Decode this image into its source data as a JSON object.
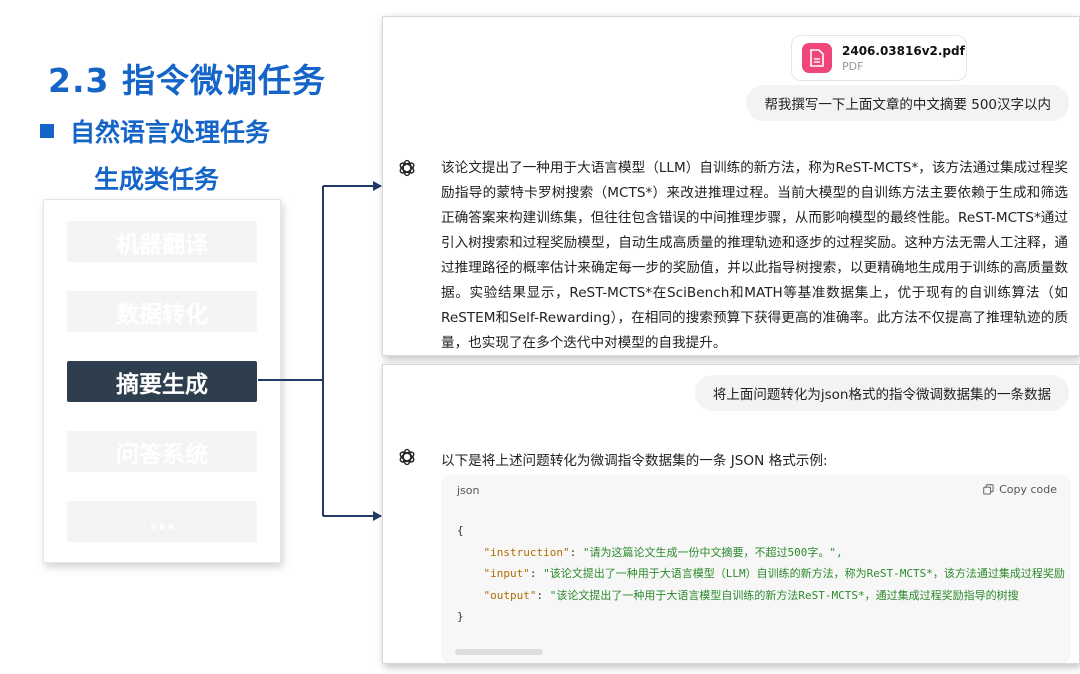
{
  "slide": {
    "title": "2.3 指令微调任务",
    "bullet": "自然语言处理任务",
    "subheading": "生成类任务",
    "tasks": [
      {
        "label": "机器翻译",
        "active": false
      },
      {
        "label": "数据转化",
        "active": false
      },
      {
        "label": "摘要生成",
        "active": true
      },
      {
        "label": "问答系统",
        "active": false
      },
      {
        "label": "...",
        "active": false
      }
    ]
  },
  "chat_top": {
    "file": {
      "name": "2406.03816v2.pdf",
      "type": "PDF"
    },
    "user_message": "帮我撰写一下上面文章的中文摘要 500汉字以内",
    "assistant_answer": "该论文提出了一种用于大语言模型（LLM）自训练的新方法，称为ReST-MCTS*，该方法通过集成过程奖励指导的蒙特卡罗树搜索（MCTS*）来改进推理过程。当前大模型的自训练方法主要依赖于生成和筛选正确答案来构建训练集，但往往包含错误的中间推理步骤，从而影响模型的最终性能。ReST-MCTS*通过引入树搜索和过程奖励模型，自动生成高质量的推理轨迹和逐步的过程奖励。这种方法无需人工注释，通过推理路径的概率估计来确定每一步的奖励值，并以此指导树搜索，以更精确地生成用于训练的高质量数据。实验结果显示，ReST-MCTS*在SciBench和MATH等基准数据集上，优于现有的自训练算法（如ReSTEM和Self-Rewarding），在相同的搜索预算下获得更高的准确率。此方法不仅提高了推理轨迹的质量，也实现了在多个迭代中对模型的自我提升。"
  },
  "chat_bottom": {
    "user_message": "将上面问题转化为json格式的指令微调数据集的一条数据",
    "assistant_intro": "以下是将上述问题转化为微调指令数据集的一条 JSON 格式示例:",
    "code": {
      "language": "json",
      "copy_label": "Copy code",
      "open_brace": "{",
      "close_brace": "}",
      "lines": [
        {
          "key": "\"instruction\"",
          "value": "\"请为这篇论文生成一份中文摘要，不超过500字。\","
        },
        {
          "key": "\"input\"",
          "value": "\"该论文提出了一种用于大语言模型（LLM）自训练的新方法，称为ReST-MCTS*，该方法通过集成过程奖励"
        },
        {
          "key": "\"output\"",
          "value": "\"该论文提出了一种用于大语言模型自训练的新方法ReST-MCTS*，通过集成过程奖励指导的树搜"
        }
      ]
    }
  },
  "colors": {
    "accent": "#1565c8",
    "active_task": "#2f3e4f",
    "pdf_icon": "#f0467a",
    "connector": "#1f3a66"
  },
  "icons": {
    "assistant": "openai-logo-icon",
    "file": "pdf-file-icon",
    "copy": "copy-icon"
  }
}
